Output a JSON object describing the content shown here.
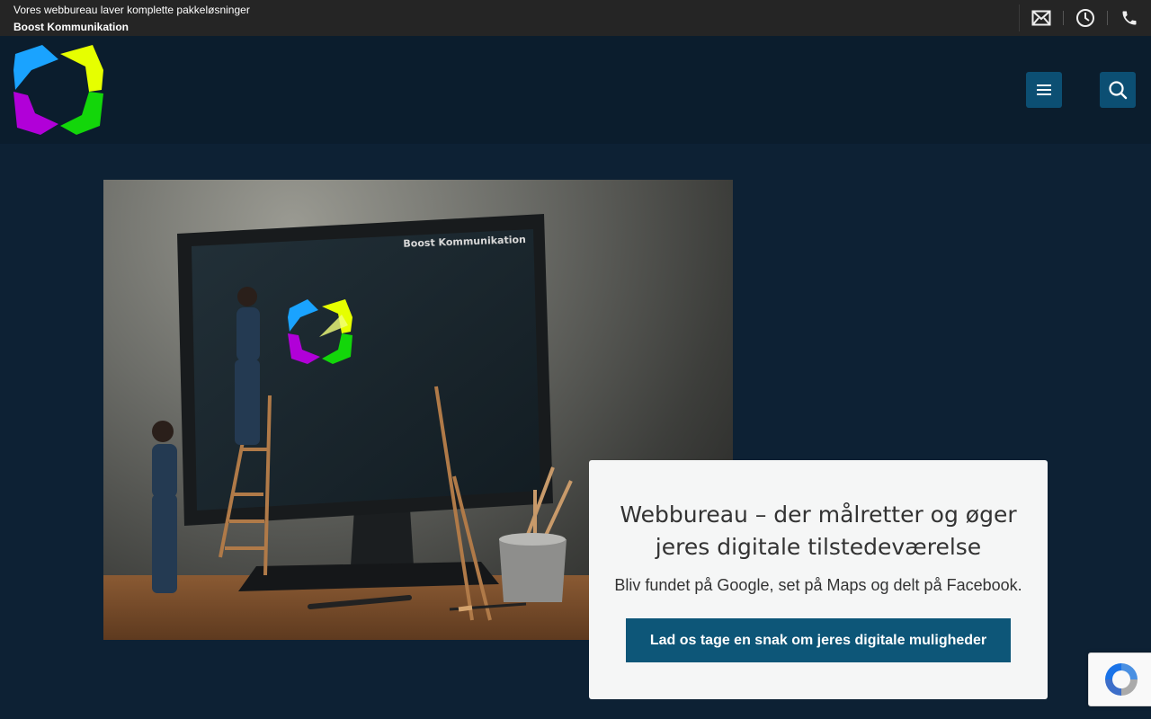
{
  "topbar": {
    "tagline": "Vores webbureau laver komplette pakkeløsninger",
    "brand": "Boost Kommunikation",
    "icons": [
      "mail-icon",
      "clock-icon",
      "phone-icon"
    ]
  },
  "header": {
    "logo_colors": [
      "#1aa3ff",
      "#e6ff00",
      "#b100d8",
      "#13d60a"
    ],
    "buttons": [
      "menu-icon",
      "search-icon"
    ]
  },
  "hero": {
    "screen_label": "Boost Kommunikation"
  },
  "card": {
    "title": "Webbureau – der målretter og øger jeres digitale tilstedeværelse",
    "subtitle": "Bliv fundet på Google, set på Maps og delt på Facebook.",
    "cta": "Lad os tage en snak om jeres digitale muligheder"
  },
  "colors": {
    "background": "#0d2134",
    "topbar": "#252525",
    "accent": "#0c4f73",
    "cta": "#0d5678"
  }
}
